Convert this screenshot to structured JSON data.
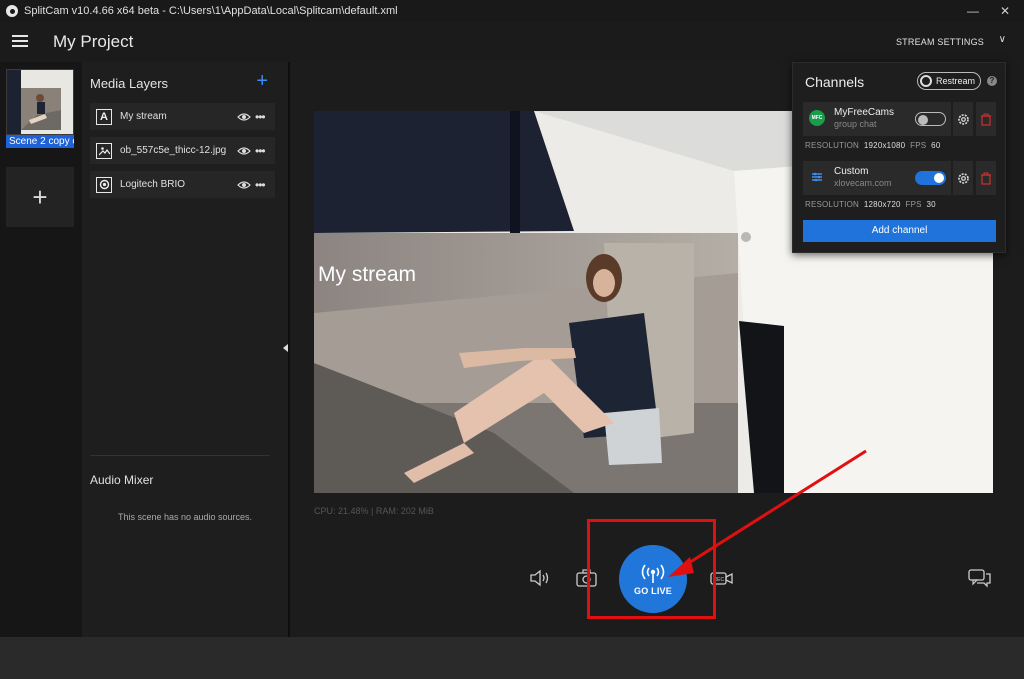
{
  "window": {
    "title": "SplitCam v10.4.66 x64 beta - C:\\Users\\1\\AppData\\Local\\Splitcam\\default.xml",
    "minimize": "—",
    "close": "✕"
  },
  "header": {
    "project_title": "My Project",
    "stream_settings": "STREAM SETTINGS",
    "stream_settings_chevron": "∨"
  },
  "scenes": {
    "items": [
      {
        "label": "Scene 2 copy c"
      }
    ],
    "add_symbol": "+"
  },
  "layers": {
    "title": "Media Layers",
    "add_symbol": "+",
    "items": [
      {
        "label": "My stream",
        "icon": "text-icon",
        "type_glyph": "A"
      },
      {
        "label": "ob_557c5e_thicc-12.jpg",
        "icon": "image-icon"
      },
      {
        "label": "Logitech BRIO",
        "icon": "webcam-icon"
      }
    ],
    "more_glyph": "•••"
  },
  "audio_mixer": {
    "title": "Audio Mixer",
    "empty_text": "This scene has no audio sources."
  },
  "preview": {
    "overlay_text": "My stream",
    "stats": "CPU: 21.48% | RAM: 202 MiB"
  },
  "toolbar": {
    "go_live": "GO LIVE"
  },
  "channels": {
    "title": "Channels",
    "restream_label": "Restream",
    "help": "?",
    "items": [
      {
        "name": "MyFreeCams",
        "subtitle": "group chat",
        "enabled": false,
        "resolution_label": "RESOLUTION",
        "resolution": "1920x1080",
        "fps_label": "FPS",
        "fps": "60",
        "logo_color": "#1a9c4a",
        "logo_text": "MFC"
      },
      {
        "name": "Custom",
        "subtitle": "xlovecam.com",
        "enabled": true,
        "resolution_label": "RESOLUTION",
        "resolution": "1280x720",
        "fps_label": "FPS",
        "fps": "30",
        "logo_color": "#3f8ef5"
      }
    ],
    "add_channel": "Add channel"
  },
  "colors": {
    "accent": "#1f73db",
    "highlight": "#e01010",
    "delete": "#d03030"
  }
}
